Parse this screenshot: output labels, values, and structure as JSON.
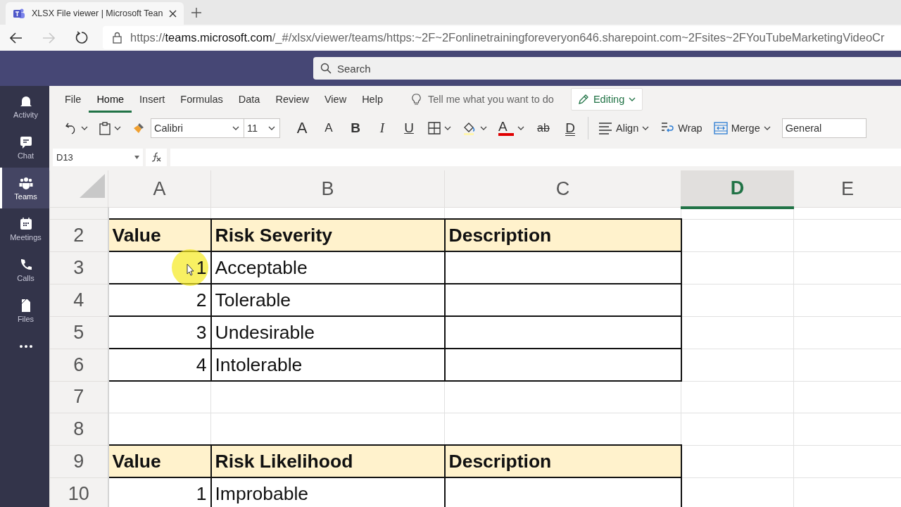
{
  "browser": {
    "tab_title": "XLSX File viewer | Microsoft Tean",
    "url_scheme": "https://",
    "url_host": "teams.microsoft.com",
    "url_path": "/_#/xlsx/viewer/teams/https:~2F~2Fonlinetrainingforeveryon646.sharepoint.com~2Fsites~2FYouTubeMarketingVideoCr"
  },
  "teams_header": {
    "search": {
      "placeholder": "Search"
    }
  },
  "app_rail": [
    {
      "label": "Activity",
      "kind": "bell",
      "selected": false
    },
    {
      "label": "Chat",
      "kind": "chat",
      "selected": false
    },
    {
      "label": "Teams",
      "kind": "teams",
      "selected": true
    },
    {
      "label": "Meetings",
      "kind": "calendar",
      "selected": false
    },
    {
      "label": "Calls",
      "kind": "phone",
      "selected": false
    },
    {
      "label": "Files",
      "kind": "file",
      "selected": false
    },
    {
      "kind": "more",
      "selected": false
    }
  ],
  "ribbon": {
    "tabs": [
      {
        "label": "File",
        "selected": false
      },
      {
        "label": "Home",
        "selected": true
      },
      {
        "label": "Insert",
        "selected": false
      },
      {
        "label": "Formulas",
        "selected": false
      },
      {
        "label": "Data",
        "selected": false
      },
      {
        "label": "Review",
        "selected": false
      },
      {
        "label": "View",
        "selected": false
      },
      {
        "label": "Help",
        "selected": false
      }
    ],
    "tell_me": {
      "placeholder": "Tell me what you want to do"
    },
    "mode_button": "Editing",
    "toolbar": [
      {
        "kind": "undo"
      },
      {
        "kind": "paste"
      },
      {
        "kind": "painter"
      },
      {
        "kind": "font",
        "value": "Calibri"
      },
      {
        "kind": "size",
        "value": "11"
      },
      {
        "kind": "grow",
        "label": "A"
      },
      {
        "kind": "shrink",
        "label": "A"
      },
      {
        "kind": "bold",
        "label": "B"
      },
      {
        "kind": "italic",
        "label": "I"
      },
      {
        "kind": "underline",
        "label": "U"
      },
      {
        "kind": "borders"
      },
      {
        "kind": "fill"
      },
      {
        "kind": "fontcolor",
        "label": "A"
      },
      {
        "kind": "strike",
        "label": "ab"
      },
      {
        "kind": "dunderline",
        "label": "D"
      },
      {
        "kind": "align",
        "label": "Align"
      },
      {
        "kind": "wrap",
        "label": "Wrap"
      },
      {
        "kind": "merge",
        "label": "Merge"
      },
      {
        "kind": "format",
        "value": "General"
      }
    ]
  },
  "formula_bar": {
    "name_box": "D13"
  },
  "sheet": {
    "columns": [
      {
        "label": "A",
        "selected": false
      },
      {
        "label": "B",
        "selected": false
      },
      {
        "label": "C",
        "selected": false
      },
      {
        "label": "D",
        "selected": true
      },
      {
        "label": "E",
        "selected": false
      }
    ],
    "rows": [
      {
        "kind": "partial"
      },
      {
        "number": "2",
        "kind": "header",
        "cells": [
          "Value",
          "Risk Severity",
          "Description"
        ]
      },
      {
        "number": "3",
        "kind": "data",
        "cells": [
          "1",
          "Acceptable"
        ]
      },
      {
        "number": "4",
        "kind": "data",
        "cells": [
          "2",
          "Tolerable"
        ]
      },
      {
        "number": "5",
        "kind": "data",
        "cells": [
          "3",
          "Undesirable"
        ]
      },
      {
        "number": "6",
        "kind": "data",
        "cells": [
          "4",
          "Intolerable"
        ]
      },
      {
        "number": "7",
        "kind": "blank"
      },
      {
        "number": "8",
        "kind": "blank"
      },
      {
        "number": "9",
        "kind": "header",
        "cells": [
          "Value",
          "Risk Likelihood",
          "Description"
        ]
      },
      {
        "number": "10",
        "kind": "data",
        "cells": [
          "1",
          "Improbable"
        ]
      }
    ]
  }
}
